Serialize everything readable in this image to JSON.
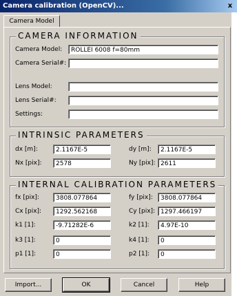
{
  "window": {
    "title": "Camera calibration (OpenCV)...",
    "close_glyph": "x"
  },
  "tab": {
    "label": "Camera Model"
  },
  "camera_info": {
    "title": "CAMERA INFORMATION",
    "model_label": "Camera Model:",
    "model_value": "ROLLEI 6008 f=80mm",
    "serial_label": "Camera Serial#:",
    "serial_value": "",
    "lens_model_label": "Lens Model:",
    "lens_model_value": "",
    "lens_serial_label": "Lens Serial#:",
    "lens_serial_value": "",
    "settings_label": "Settings:",
    "settings_value": ""
  },
  "intrinsic": {
    "title": "INTRINSIC PARAMETERS",
    "dx_label": "dx [m]:",
    "dx_value": "2.1167E-5",
    "dy_label": "dy [m]:",
    "dy_value": "2.1167E-5",
    "nx_label": "Nx [pix]:",
    "nx_value": "2578",
    "ny_label": "Ny [pix]:",
    "ny_value": "2611"
  },
  "internal": {
    "title": "INTERNAL CALIBRATION PARAMETERS",
    "fx_label": "fx [pix]:",
    "fx_value": "3808.077864",
    "fy_label": "fy [pix]:",
    "fy_value": "3808.077864",
    "cx_label": "Cx [pix]:",
    "cx_value": "1292.562168",
    "cy_label": "Cy [pix]:",
    "cy_value": "1297.466197",
    "k1_label": "k1 [1]:",
    "k1_value": "-9.71282E-6",
    "k2_label": "k2 [1]:",
    "k2_value": "4.97E-10",
    "k3_label": "k3 [1]:",
    "k3_value": "0",
    "k4_label": "k4 [1]:",
    "k4_value": "0",
    "p1_label": "p1 [1]:",
    "p1_value": "0",
    "p2_label": "p2 [1]:",
    "p2_value": "0"
  },
  "buttons": {
    "import": "Import...",
    "ok": "OK",
    "cancel": "Cancel",
    "help": "Help"
  },
  "colors": {
    "face": "#d4d0c8",
    "title_start": "#0a246a",
    "title_end": "#a6caf0"
  }
}
